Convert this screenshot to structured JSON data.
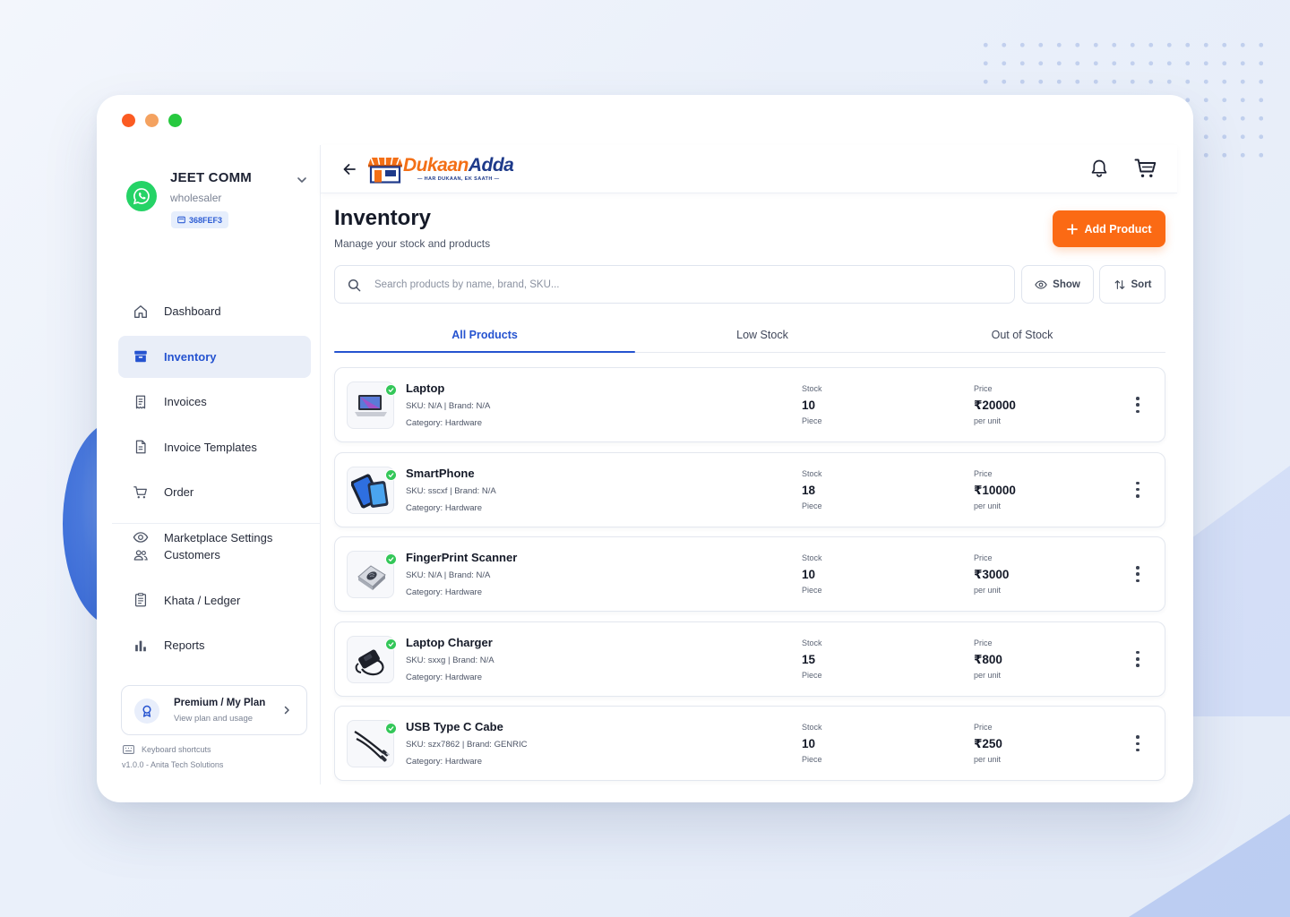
{
  "profile": {
    "name": "JEET COMM",
    "role": "wholesaler",
    "id": "368FEF3"
  },
  "sidebar": {
    "primary": [
      {
        "label": "Dashboard",
        "icon": "home-icon"
      },
      {
        "label": "Inventory",
        "icon": "archive-box-icon",
        "active": true
      },
      {
        "label": "Invoices",
        "icon": "receipt-icon"
      },
      {
        "label": "Invoice Templates",
        "icon": "document-icon"
      },
      {
        "label": "Order",
        "icon": "cart-icon"
      },
      {
        "label": "Marketplace Settings",
        "icon": "eye-icon"
      }
    ],
    "secondary": [
      {
        "label": "Customers",
        "icon": "users-icon"
      },
      {
        "label": "Khata / Ledger",
        "icon": "ledger-icon"
      },
      {
        "label": "Reports",
        "icon": "bar-chart-icon"
      }
    ],
    "plan": {
      "title": "Premium / My Plan",
      "subtitle": "View plan and usage"
    },
    "keyboard_shortcuts": "Keyboard shortcuts",
    "version": "v1.0.0 - Anita Tech Solutions"
  },
  "header": {
    "logo": {
      "part1": "Dukaan",
      "part2": "Adda",
      "tagline": "HAR DUKAAN, EK SAATH"
    }
  },
  "page": {
    "title": "Inventory",
    "subtitle": "Manage your stock and products",
    "add_button": "Add Product",
    "search_placeholder": "Search products by name, brand, SKU...",
    "show_label": "Show",
    "sort_label": "Sort"
  },
  "tabs": [
    {
      "label": "All Products",
      "active": true
    },
    {
      "label": "Low Stock"
    },
    {
      "label": "Out of Stock"
    }
  ],
  "products": [
    {
      "name": "Laptop",
      "meta": "SKU: N/A | Brand: N/A",
      "category": "Category: Hardware",
      "stock_label": "Stock",
      "stock": "10",
      "unit": "Piece",
      "price_label": "Price",
      "price": "₹20000",
      "per": "per unit",
      "image": "laptop"
    },
    {
      "name": "SmartPhone",
      "meta": "SKU: sscxf | Brand: N/A",
      "category": "Category: Hardware",
      "stock_label": "Stock",
      "stock": "18",
      "unit": "Piece",
      "price_label": "Price",
      "price": "₹10000",
      "per": "per unit",
      "image": "phone"
    },
    {
      "name": "FingerPrint Scanner",
      "meta": "SKU: N/A | Brand: N/A",
      "category": "Category: Hardware",
      "stock_label": "Stock",
      "stock": "10",
      "unit": "Piece",
      "price_label": "Price",
      "price": "₹3000",
      "per": "per unit",
      "image": "scanner"
    },
    {
      "name": "Laptop Charger",
      "meta": "SKU: sxxg | Brand: N/A",
      "category": "Category: Hardware",
      "stock_label": "Stock",
      "stock": "15",
      "unit": "Piece",
      "price_label": "Price",
      "price": "₹800",
      "per": "per unit",
      "image": "charger"
    },
    {
      "name": "USB Type C Cabe",
      "meta": "SKU: szx7862 | Brand: GENRIC",
      "category": "Category: Hardware",
      "stock_label": "Stock",
      "stock": "10",
      "unit": "Piece",
      "price_label": "Price",
      "price": "₹250",
      "per": "per unit",
      "image": "cable"
    }
  ],
  "colors": {
    "accent": "#2553d0",
    "brand_orange": "#fb6a14",
    "brand_navy": "#1e3a8a",
    "success": "#34c759",
    "whatsapp": "#25d366"
  }
}
